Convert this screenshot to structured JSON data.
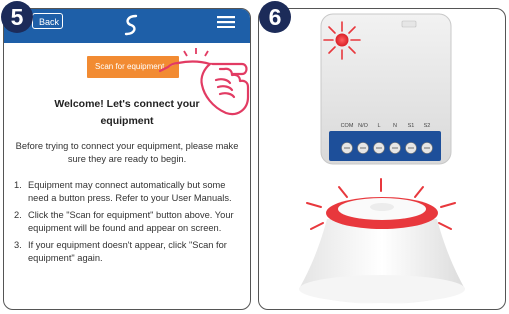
{
  "step5": {
    "number": "5"
  },
  "step6": {
    "number": "6"
  },
  "appbar": {
    "back_label": "Back",
    "logo_icon": "swirl-logo-icon",
    "menu_icon": "hamburger-menu-icon",
    "color": "#1e5fa8"
  },
  "scan_button": {
    "label": "Scan for equipment",
    "color": "#f28b32"
  },
  "welcome": {
    "line1": "Welcome! Let's connect your",
    "line2": "equipment"
  },
  "intro": "Before trying to connect your equipment, please make sure they are ready to begin.",
  "steps": [
    {
      "num": "1.",
      "text": "Equipment may connect automatically but some need a button press. Refer to your User Manuals."
    },
    {
      "num": "2.",
      "text": "Click the \"Scan for equipment\" button above. Your equipment will be found and appear on screen."
    },
    {
      "num": "3.",
      "text": "If your equipment doesn't appear, click \"Scan for equipment\" again."
    }
  ],
  "device": {
    "terminal_labels": [
      "COM",
      "N/O",
      "L",
      "N",
      "S1",
      "S2"
    ],
    "led_color": "#e8383d",
    "hub_ring_color": "#e8383d"
  }
}
